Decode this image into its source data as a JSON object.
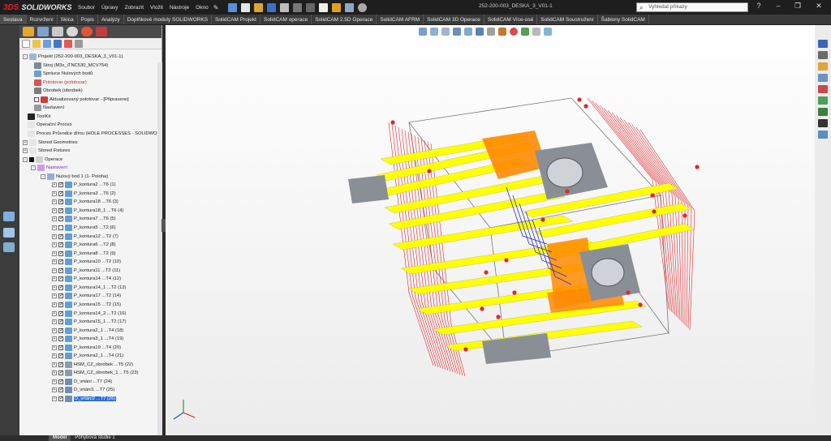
{
  "app": {
    "brand_prefix": "3DS",
    "brand": "SOLIDWORKS",
    "doc_title": "252-200-003_DESKA_3_V01-1"
  },
  "menu": [
    "Soubor",
    "Úpravy",
    "Zobrazit",
    "Vložit",
    "Nástroje",
    "Okno"
  ],
  "search": {
    "placeholder": "Vyhledat příkazy"
  },
  "cmd_tabs": [
    "Sestava",
    "Rozvržení",
    "Skica",
    "Popis",
    "Analýzy",
    "Doplňkové moduly SOLIDWORKS",
    "SolidCAM Projekt",
    "SolidCAM operace",
    "SolidCAM 2.5D Operace",
    "SolidCAM AFRM",
    "SolidCAM 3D Operace",
    "SolidCAM Více-osé",
    "SolidCAM Soustružení",
    "Šablony SolidCAM"
  ],
  "tree": {
    "project": "Projekt (252-200-003_DESKA_3_V01-1)",
    "machine": "Stroj (M3x_iTNC530_MCV754)",
    "zero_manager": "Správce Nulových bodů",
    "stock": "Polotovar (polotovar)",
    "target": "Obrobek (obrobek)",
    "updated_stock": "Aktualizovaný polotovar - [Připraveno]",
    "settings": "Nastavení",
    "toolkit": "ToolKit",
    "op_process": "Operační Proces",
    "hole_process": "Proces Průvodce dírou (HOLE PROCESSES - SOLIDWORKS",
    "stored_geom": "Stored Geometries",
    "stored_fix": "Stored Fixtures",
    "operations": "Operace",
    "op_settings": "Nastavení",
    "zero_point": "Nulový bod 1 (1- Poloha)",
    "ops": [
      {
        "label": "P_kontura2 ...T6 (1)",
        "checked": true
      },
      {
        "label": "P_kontura3 ...T6 (2)",
        "checked": true
      },
      {
        "label": "P_kontura18 ...T6 (3)",
        "checked": true
      },
      {
        "label": "P_kontura18_1 ...T6 (4)",
        "checked": true
      },
      {
        "label": "P_kontura7 ...T6 (5)",
        "checked": true
      },
      {
        "label": "P_kontura5 ...T2 (6)",
        "checked": false
      },
      {
        "label": "P_kontura12 ...T2 (7)",
        "checked": true
      },
      {
        "label": "P_kontura6 ...T2 (8)",
        "checked": true
      },
      {
        "label": "P_kontura8 ...T2 (9)",
        "checked": true
      },
      {
        "label": "P_kontura10 ...T2 (10)",
        "checked": true
      },
      {
        "label": "P_kontura11 ...T2 (11)",
        "checked": true
      },
      {
        "label": "P_kontura14 ...T4 (12)",
        "checked": true
      },
      {
        "label": "P_kontura14_1 ...T2 (13)",
        "checked": true
      },
      {
        "label": "P_kontura17 ...T2 (14)",
        "checked": true
      },
      {
        "label": "P_kontura15 ...T2 (15)",
        "checked": true
      },
      {
        "label": "P_kontura14_2 ...T2 (16)",
        "checked": true
      },
      {
        "label": "P_kontura15_1 ...T2 (17)",
        "checked": true
      },
      {
        "label": "P_kontura2_1 ...T4 (18)",
        "checked": true
      },
      {
        "label": "P_kontura3_1 ...T4 (19)",
        "checked": true
      },
      {
        "label": "P_kontura19 ...T4 (20)",
        "checked": true
      },
      {
        "label": "P_kontura2_1 ...T4 (21)",
        "checked": true
      },
      {
        "label": "HSM_CZ_obrobek ...T5 (22)",
        "checked": true
      },
      {
        "label": "HSM_CZ_obrobek_1 ...T5 (23)",
        "checked": true
      },
      {
        "label": "D_vrtání ...T7 (24)",
        "checked": true
      },
      {
        "label": "D_vrtání1 ...T7 (25)",
        "checked": true
      },
      {
        "label": "D_vrtání2 ...T7 (26)",
        "checked": true,
        "selected": true
      }
    ]
  },
  "bottom_tabs": [
    "Model",
    "Pohybová studie 1"
  ],
  "colors": {
    "path_red": "#e0262b",
    "path_blue": "#2d2fb8",
    "slab_yellow": "#ffff00",
    "slab_orange": "#ff8a00",
    "body_gray": "#8a8f96",
    "select_blue": "#2f6fd6"
  }
}
